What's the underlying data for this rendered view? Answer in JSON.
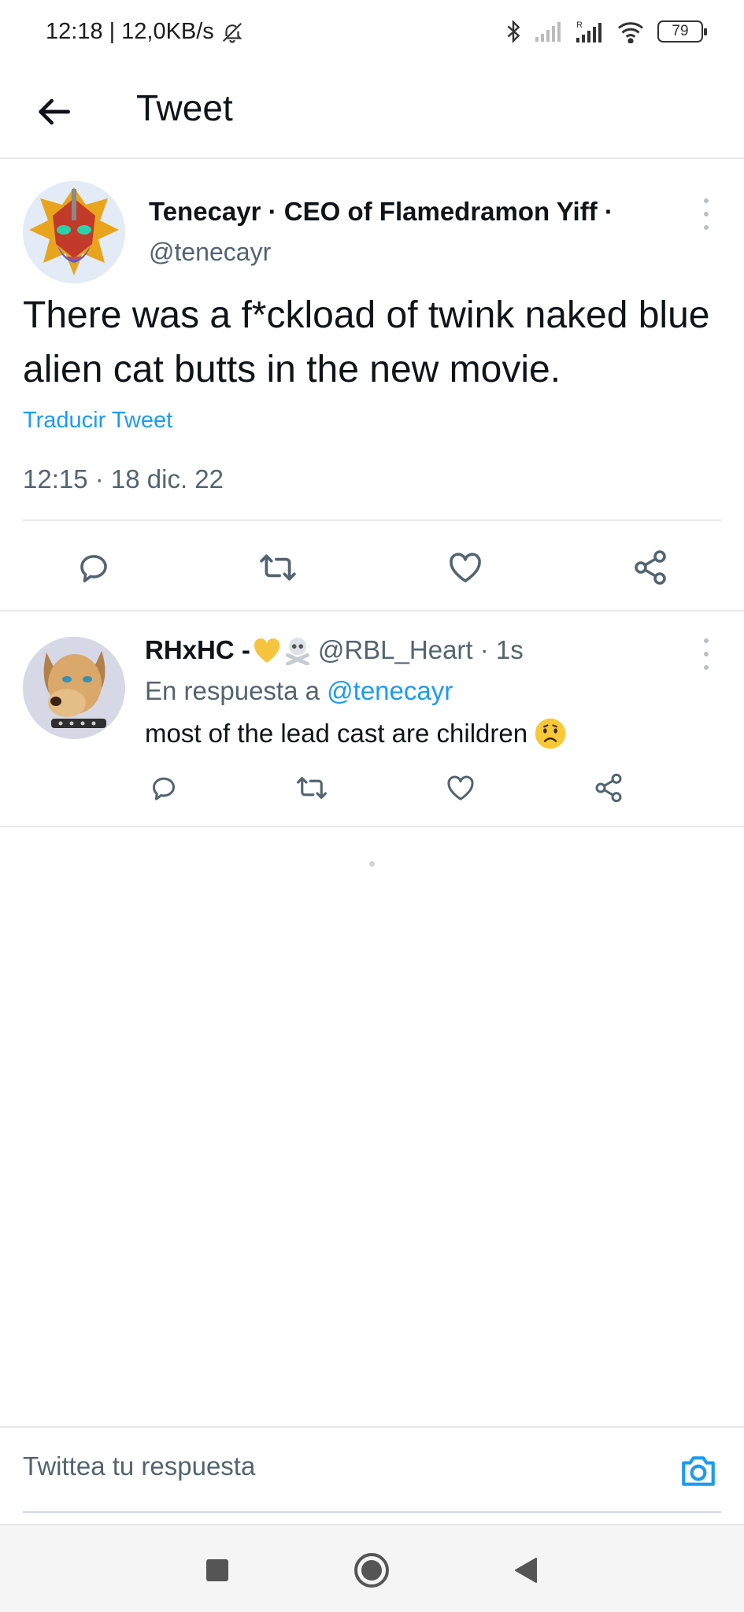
{
  "status_bar": {
    "time": "12:18",
    "separator": "|",
    "net_speed": "12,0KB/s",
    "battery": "79"
  },
  "header": {
    "title": "Tweet"
  },
  "main_tweet": {
    "author_name": "Tenecayr · CEO of Flamedramon Yiff ·",
    "author_handle": "@tenecayr",
    "text": "There was a f*ckload of twink naked blue alien cat butts in the new movie.",
    "translate_label": "Traducir Tweet",
    "timestamp": "12:15 · 18 dic. 22"
  },
  "reply": {
    "author_name": "RHxHC -",
    "author_handle": "@RBL_Heart · 1s",
    "context_prefix": "En respuesta a",
    "context_mention": "@tenecayr",
    "text": "most of the lead cast are children"
  },
  "compose": {
    "placeholder": "Twittea tu respuesta"
  },
  "colors": {
    "accent": "#1d9bf0",
    "text": "#0f1419",
    "muted": "#536471",
    "divider": "#e6e8ea"
  },
  "icons": {
    "back": "arrow-left-icon",
    "reply": "reply-icon",
    "retweet": "retweet-icon",
    "like": "heart-icon",
    "share": "share-icon",
    "camera": "camera-icon"
  }
}
